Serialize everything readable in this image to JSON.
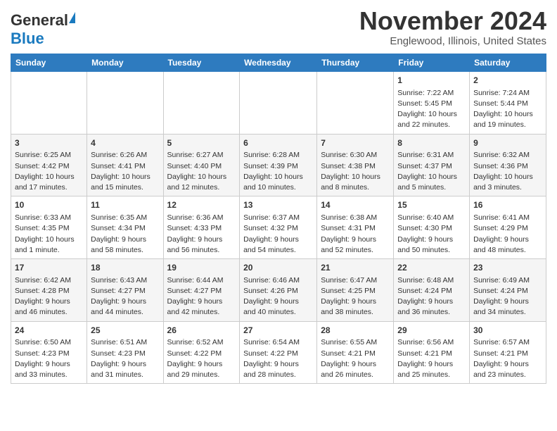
{
  "header": {
    "logo_general": "General",
    "logo_blue": "Blue",
    "title": "November 2024",
    "subtitle": "Englewood, Illinois, United States"
  },
  "calendar": {
    "days_of_week": [
      "Sunday",
      "Monday",
      "Tuesday",
      "Wednesday",
      "Thursday",
      "Friday",
      "Saturday"
    ],
    "weeks": [
      [
        {
          "day": "",
          "info": ""
        },
        {
          "day": "",
          "info": ""
        },
        {
          "day": "",
          "info": ""
        },
        {
          "day": "",
          "info": ""
        },
        {
          "day": "",
          "info": ""
        },
        {
          "day": "1",
          "info": "Sunrise: 7:22 AM\nSunset: 5:45 PM\nDaylight: 10 hours\nand 22 minutes."
        },
        {
          "day": "2",
          "info": "Sunrise: 7:24 AM\nSunset: 5:44 PM\nDaylight: 10 hours\nand 19 minutes."
        }
      ],
      [
        {
          "day": "3",
          "info": "Sunrise: 6:25 AM\nSunset: 4:42 PM\nDaylight: 10 hours\nand 17 minutes."
        },
        {
          "day": "4",
          "info": "Sunrise: 6:26 AM\nSunset: 4:41 PM\nDaylight: 10 hours\nand 15 minutes."
        },
        {
          "day": "5",
          "info": "Sunrise: 6:27 AM\nSunset: 4:40 PM\nDaylight: 10 hours\nand 12 minutes."
        },
        {
          "day": "6",
          "info": "Sunrise: 6:28 AM\nSunset: 4:39 PM\nDaylight: 10 hours\nand 10 minutes."
        },
        {
          "day": "7",
          "info": "Sunrise: 6:30 AM\nSunset: 4:38 PM\nDaylight: 10 hours\nand 8 minutes."
        },
        {
          "day": "8",
          "info": "Sunrise: 6:31 AM\nSunset: 4:37 PM\nDaylight: 10 hours\nand 5 minutes."
        },
        {
          "day": "9",
          "info": "Sunrise: 6:32 AM\nSunset: 4:36 PM\nDaylight: 10 hours\nand 3 minutes."
        }
      ],
      [
        {
          "day": "10",
          "info": "Sunrise: 6:33 AM\nSunset: 4:35 PM\nDaylight: 10 hours\nand 1 minute."
        },
        {
          "day": "11",
          "info": "Sunrise: 6:35 AM\nSunset: 4:34 PM\nDaylight: 9 hours\nand 58 minutes."
        },
        {
          "day": "12",
          "info": "Sunrise: 6:36 AM\nSunset: 4:33 PM\nDaylight: 9 hours\nand 56 minutes."
        },
        {
          "day": "13",
          "info": "Sunrise: 6:37 AM\nSunset: 4:32 PM\nDaylight: 9 hours\nand 54 minutes."
        },
        {
          "day": "14",
          "info": "Sunrise: 6:38 AM\nSunset: 4:31 PM\nDaylight: 9 hours\nand 52 minutes."
        },
        {
          "day": "15",
          "info": "Sunrise: 6:40 AM\nSunset: 4:30 PM\nDaylight: 9 hours\nand 50 minutes."
        },
        {
          "day": "16",
          "info": "Sunrise: 6:41 AM\nSunset: 4:29 PM\nDaylight: 9 hours\nand 48 minutes."
        }
      ],
      [
        {
          "day": "17",
          "info": "Sunrise: 6:42 AM\nSunset: 4:28 PM\nDaylight: 9 hours\nand 46 minutes."
        },
        {
          "day": "18",
          "info": "Sunrise: 6:43 AM\nSunset: 4:27 PM\nDaylight: 9 hours\nand 44 minutes."
        },
        {
          "day": "19",
          "info": "Sunrise: 6:44 AM\nSunset: 4:27 PM\nDaylight: 9 hours\nand 42 minutes."
        },
        {
          "day": "20",
          "info": "Sunrise: 6:46 AM\nSunset: 4:26 PM\nDaylight: 9 hours\nand 40 minutes."
        },
        {
          "day": "21",
          "info": "Sunrise: 6:47 AM\nSunset: 4:25 PM\nDaylight: 9 hours\nand 38 minutes."
        },
        {
          "day": "22",
          "info": "Sunrise: 6:48 AM\nSunset: 4:24 PM\nDaylight: 9 hours\nand 36 minutes."
        },
        {
          "day": "23",
          "info": "Sunrise: 6:49 AM\nSunset: 4:24 PM\nDaylight: 9 hours\nand 34 minutes."
        }
      ],
      [
        {
          "day": "24",
          "info": "Sunrise: 6:50 AM\nSunset: 4:23 PM\nDaylight: 9 hours\nand 33 minutes."
        },
        {
          "day": "25",
          "info": "Sunrise: 6:51 AM\nSunset: 4:23 PM\nDaylight: 9 hours\nand 31 minutes."
        },
        {
          "day": "26",
          "info": "Sunrise: 6:52 AM\nSunset: 4:22 PM\nDaylight: 9 hours\nand 29 minutes."
        },
        {
          "day": "27",
          "info": "Sunrise: 6:54 AM\nSunset: 4:22 PM\nDaylight: 9 hours\nand 28 minutes."
        },
        {
          "day": "28",
          "info": "Sunrise: 6:55 AM\nSunset: 4:21 PM\nDaylight: 9 hours\nand 26 minutes."
        },
        {
          "day": "29",
          "info": "Sunrise: 6:56 AM\nSunset: 4:21 PM\nDaylight: 9 hours\nand 25 minutes."
        },
        {
          "day": "30",
          "info": "Sunrise: 6:57 AM\nSunset: 4:21 PM\nDaylight: 9 hours\nand 23 minutes."
        }
      ]
    ]
  }
}
